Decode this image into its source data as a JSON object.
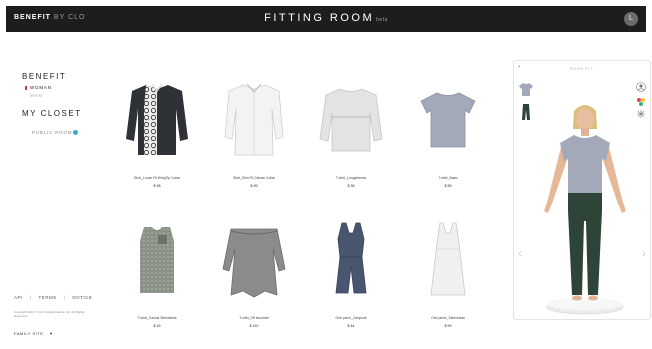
{
  "topbar": {
    "brand_main": "BENEFIT",
    "brand_sub": "BY CLO",
    "title": "FITTING ROOM",
    "title_badge": "beta",
    "user_initial": "L"
  },
  "sidebar": {
    "section1": "BENEFIT",
    "items": [
      {
        "label": "WOMAN",
        "active": true
      },
      {
        "label": "MAN",
        "active": false
      }
    ],
    "section2": "MY CLOSET",
    "public_room": "PUBLIC ROOM"
  },
  "footer": {
    "links": [
      "API",
      "TERMS",
      "NOTICE"
    ],
    "copyright": "Copyright 2019 © CLO Virtual Fashion Inc. All Rights Reserved.",
    "family_site": "FAMILY SITE"
  },
  "products": [
    {
      "name": "Shirt_Loose Fit WingTip Collar",
      "price": "$ 98",
      "icon": "patterned-shirt-icon",
      "color": "#2e3135"
    },
    {
      "name": "Shirt_Slim Fit Classic Collar",
      "price": "$ 99",
      "icon": "white-shirt-icon",
      "color": "#f4f4f4"
    },
    {
      "name": "T-shirt_Longsleeves",
      "price": "$ 35",
      "icon": "longsleeve-icon",
      "color": "#e3e3e3"
    },
    {
      "name": "T-shirt_Basic",
      "price": "$ 55",
      "icon": "basic-tshirt-icon",
      "color": "#a4a9ba"
    },
    {
      "name": "T-shirt_Casual Sleeveless",
      "price": "$ 15",
      "icon": "sleeveless-top-icon",
      "color": "#8a9186"
    },
    {
      "name": "T-shirt_Off shoulder",
      "price": "$ 110",
      "icon": "off-shoulder-icon",
      "color": "#8b8b8b"
    },
    {
      "name": "One piece_Jumpsuit",
      "price": "$ 44",
      "icon": "jumpsuit-icon",
      "color": "#4a5570"
    },
    {
      "name": "One piece_Sleeveless",
      "price": "$ 99",
      "icon": "sleeveless-dress-icon",
      "color": "#ececec"
    }
  ],
  "fitting": {
    "header": "BENEFIT",
    "back": "›",
    "arrow_left": "‹",
    "arrow_right": "›"
  }
}
